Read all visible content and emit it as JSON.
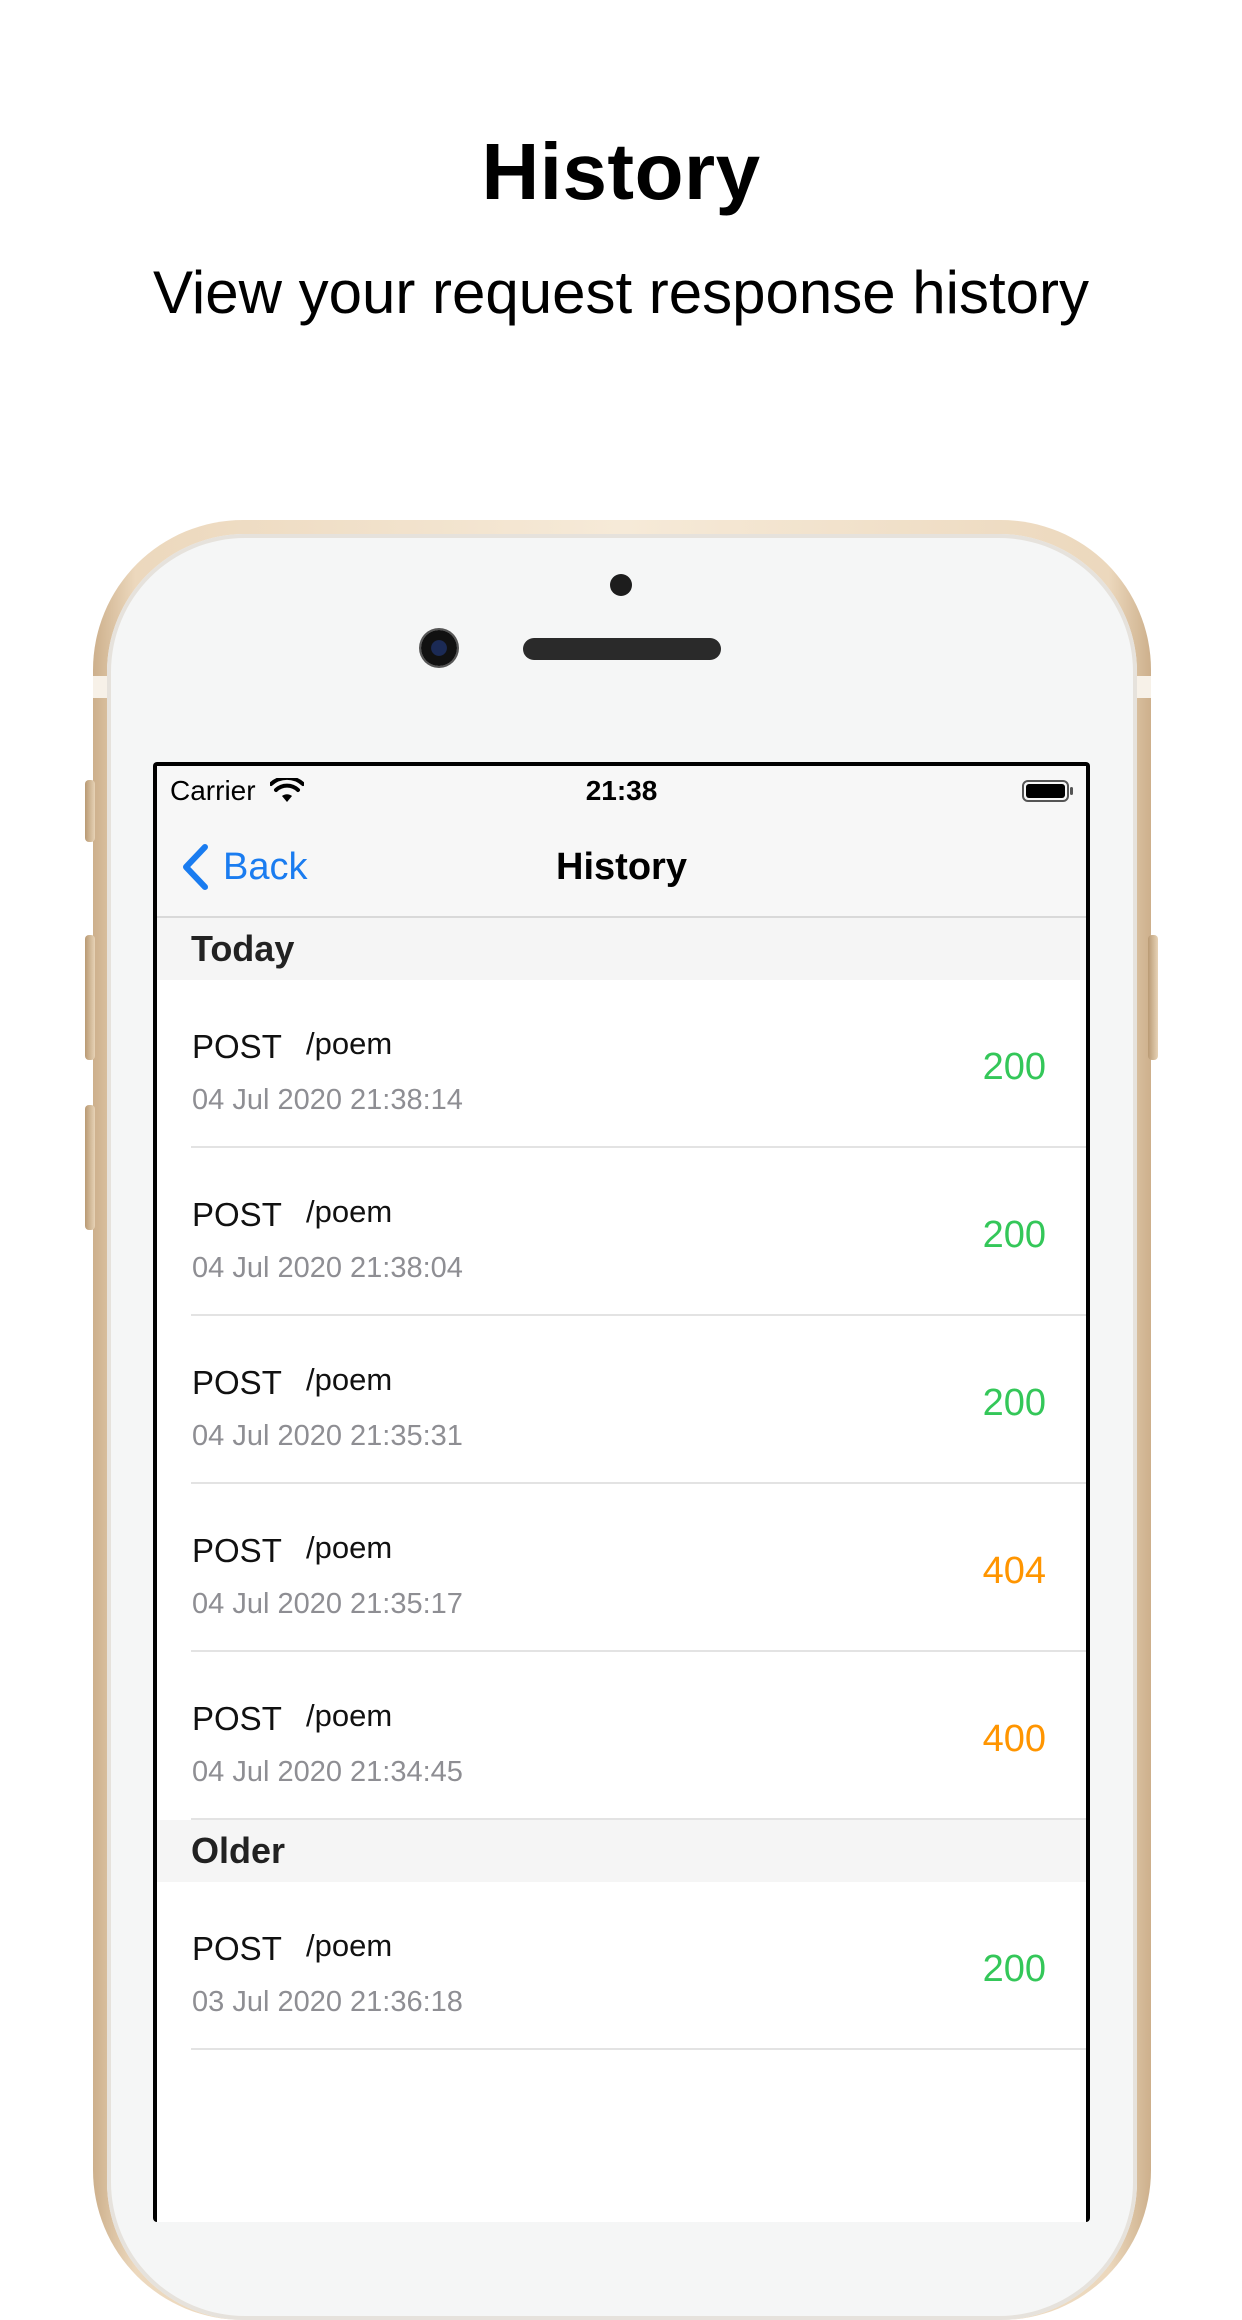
{
  "promo": {
    "title": "History",
    "subtitle": "View your request response history"
  },
  "statusbar": {
    "carrier": "Carrier",
    "time": "21:38",
    "icons": [
      "wifi-icon",
      "battery-icon"
    ]
  },
  "navbar": {
    "back_label": "Back",
    "title": "History",
    "back_icon": "chevron-left-icon"
  },
  "colors": {
    "accent": "#1a7cf0",
    "success": "#34c759",
    "warning": "#ff9500",
    "secondary_text": "#8e8e93"
  },
  "sections": [
    {
      "header": "Today",
      "rows": [
        {
          "method": "POST",
          "path": "/poem",
          "date": "04 Jul 2020 21:38:14",
          "status": "200"
        },
        {
          "method": "POST",
          "path": "/poem",
          "date": "04 Jul 2020 21:38:04",
          "status": "200"
        },
        {
          "method": "POST",
          "path": "/poem",
          "date": "04 Jul 2020 21:35:31",
          "status": "200"
        },
        {
          "method": "POST",
          "path": "/poem",
          "date": "04 Jul 2020 21:35:17",
          "status": "404"
        },
        {
          "method": "POST",
          "path": "/poem",
          "date": "04 Jul 2020 21:34:45",
          "status": "400"
        }
      ]
    },
    {
      "header": "Older",
      "rows": [
        {
          "method": "POST",
          "path": "/poem",
          "date": "03 Jul 2020 21:36:18",
          "status": "200"
        }
      ]
    }
  ]
}
